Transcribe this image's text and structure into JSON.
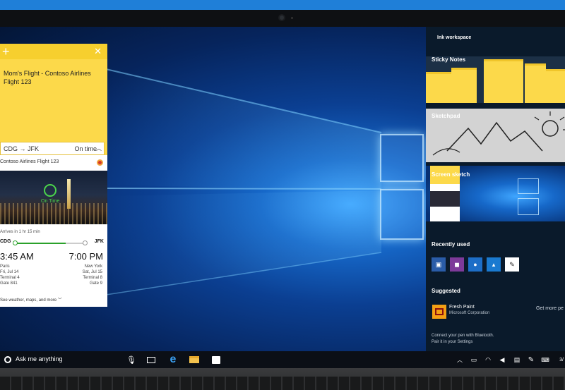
{
  "ink_workspace": {
    "title": "Ink workspace",
    "sticky_notes_label": "Sticky Notes",
    "sketchpad_label": "Sketchpad",
    "screen_sketch_label": "Screen sketch",
    "recently_used_label": "Recently used",
    "recent_apps": [
      "video-app-icon",
      "onenote-icon",
      "maps-icon",
      "photos-icon",
      "pen-app-icon"
    ],
    "suggested_label": "Suggested",
    "suggested_app": {
      "name": "Fresh Paint",
      "publisher": "Microsoft Corporation"
    },
    "get_more": "Get more pe",
    "connect_line1": "Connect your pen with Bluetooth.",
    "connect_line2": "Pair it in your Settings"
  },
  "sticky": {
    "text": "Mom's Flight - Contoso Airlines Flight 123",
    "route": "CDG → JFK",
    "status": "On time"
  },
  "flight_card": {
    "title": "Contoso Airlines Flight 123",
    "map_status": "On Time",
    "arrives": "Arrives in 1 hr 15 min",
    "from": "CDG",
    "to": "JFK",
    "progress": 0.72,
    "dep_time": "3:45 AM",
    "arr_time": "7:00 PM",
    "dep_city": "Paris",
    "dep_date": "Fri, Jul 14",
    "dep_terminal": "Terminal 4",
    "dep_gate": "Gate 841",
    "arr_city": "New York",
    "arr_date": "Sat, Jul 15",
    "arr_terminal": "Terminal 8",
    "arr_gate": "Gate 9",
    "see_more": "See weather, maps, and more"
  },
  "taskbar": {
    "search_placeholder": "Ask me anything",
    "clock": "3/"
  },
  "colors": {
    "accent": "#1f7fd8",
    "sticky_yellow": "#fcd94a",
    "ontime_green": "#4bd44b",
    "taskbar": "#0b0f16"
  }
}
